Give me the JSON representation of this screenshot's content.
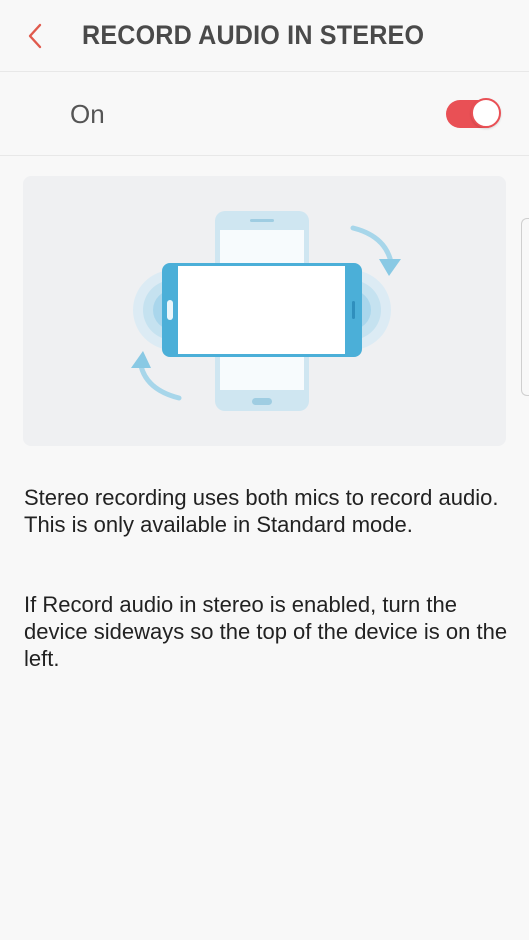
{
  "header": {
    "title": "RECORD AUDIO IN STEREO",
    "back_icon": "chevron-left-icon"
  },
  "switch_row": {
    "label": "On",
    "enabled": true,
    "accent_color": "#e95055"
  },
  "illustration": {
    "icon": "stereo-rotate-device-illustration",
    "colors": {
      "device_blue": "#4bafd8",
      "device_light": "#c7e3ef",
      "wave": "#a9d7ec",
      "arrow": "#a7d6ea",
      "card_bg": "#eff0f2"
    }
  },
  "description": {
    "paragraph_1": "Stereo recording uses both mics to record audio. This is only available in Standard mode.",
    "paragraph_2": "If Record audio in stereo is enabled, turn the device sideways so the top of the device is on the left."
  }
}
